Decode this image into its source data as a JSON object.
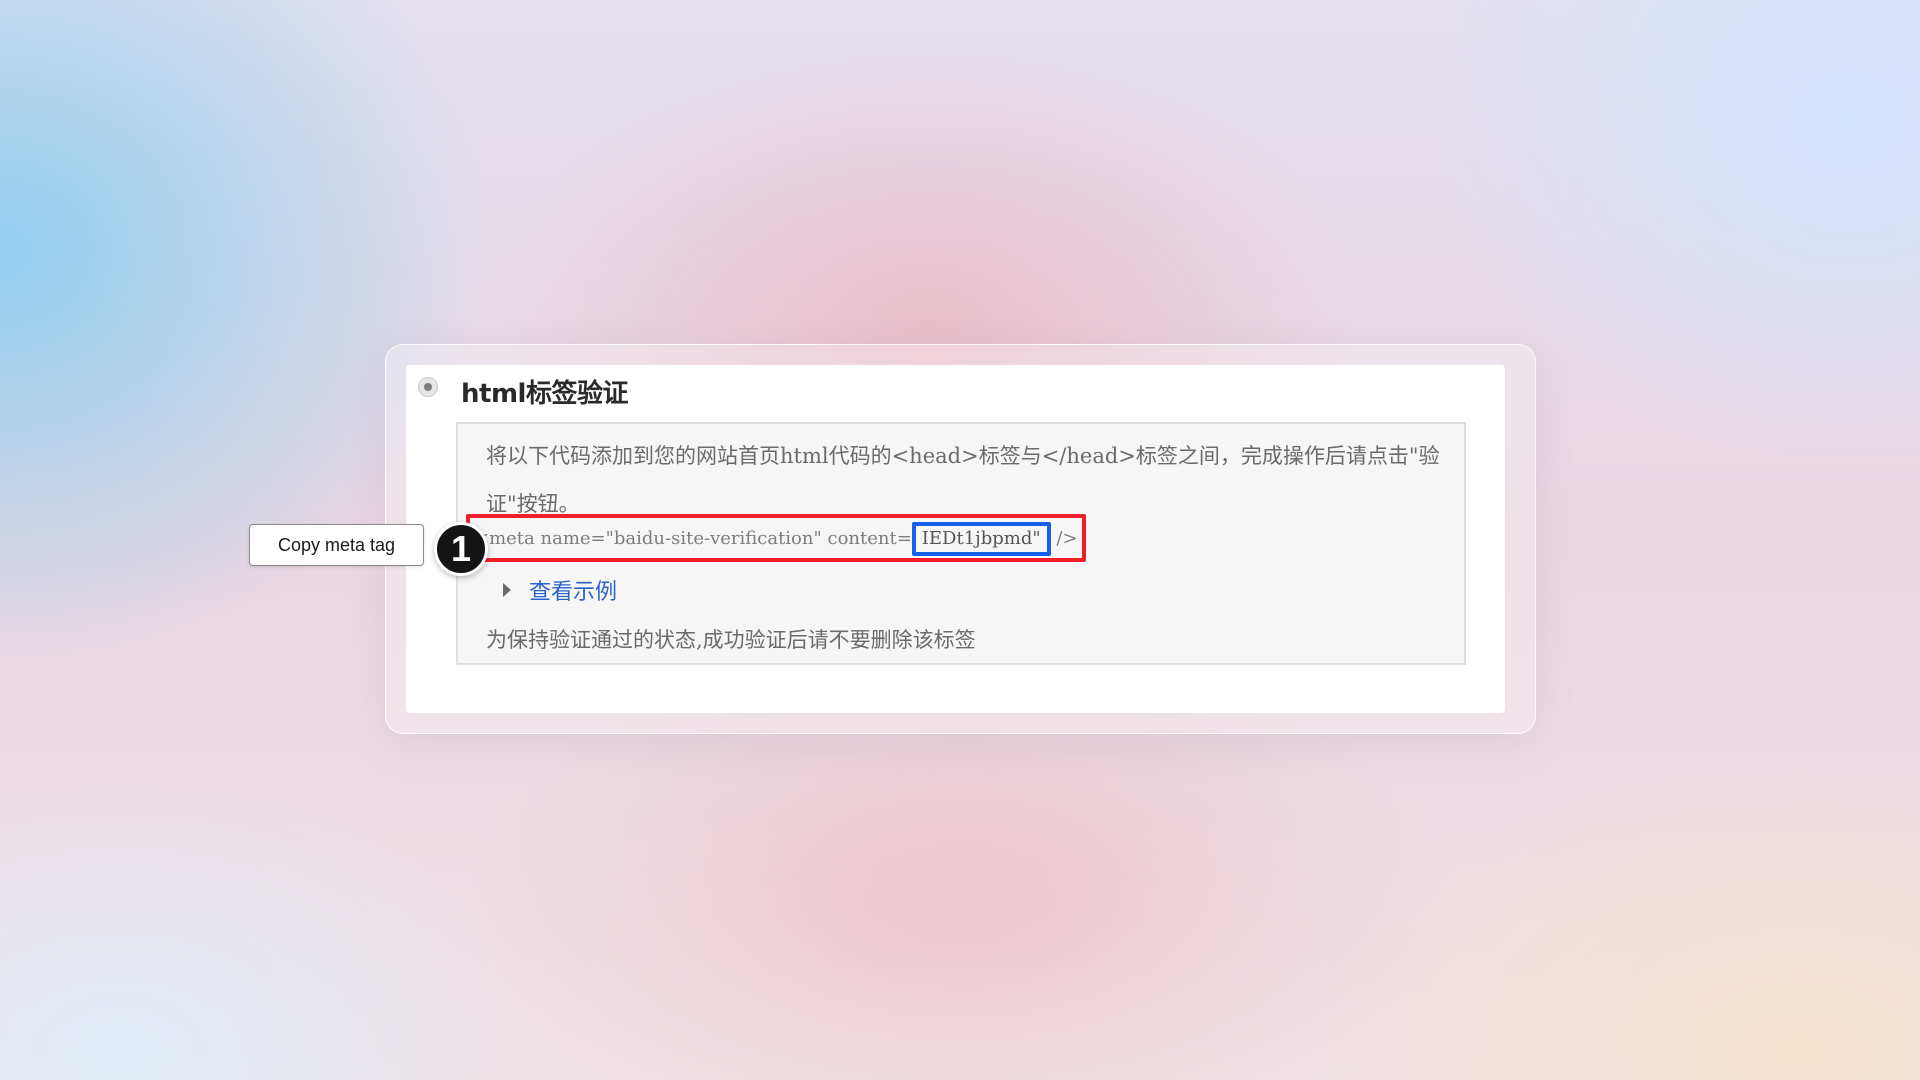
{
  "option": {
    "title": "html标签验证",
    "selected": true
  },
  "instructions": {
    "description": "将以下代码添加到您的网站首页html代码的<head>标签与</head>标签之间，完成操作后请点击\"验证\"按钮。",
    "code_prefix": "<meta name=\"baidu-site-verification\" content=",
    "code_value": "IEDt1jbpmd\"",
    "code_suffix": " />",
    "example_link": "查看示例",
    "note": "为保持验证通过的状态,成功验证后请不要删除该标签"
  },
  "annotation": {
    "tooltip": "Copy meta tag",
    "step_number": "1"
  },
  "colors": {
    "highlight_red": "#ef1f2a",
    "highlight_blue": "#1560e8",
    "link_blue": "#2b63c8"
  }
}
